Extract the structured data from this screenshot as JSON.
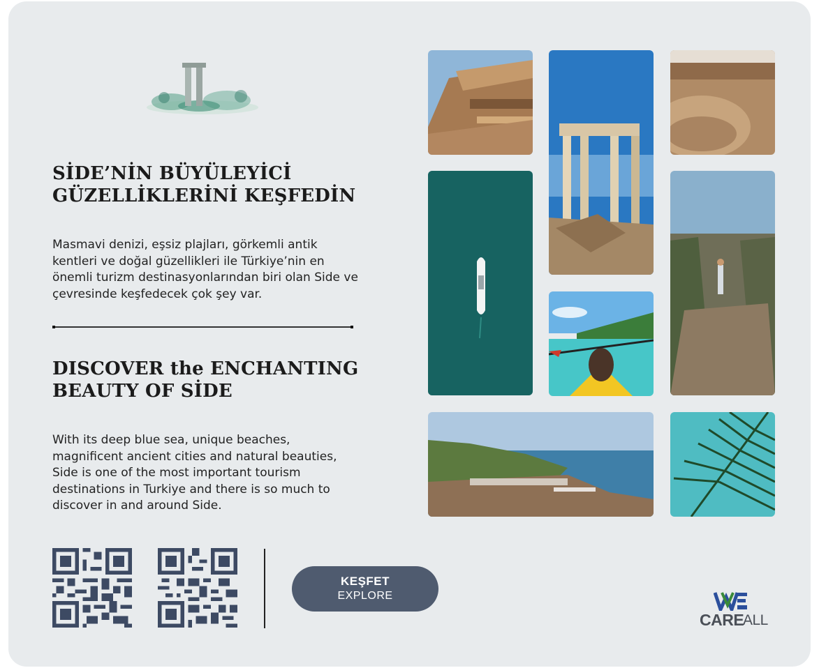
{
  "heading_tr": "SİDE’NİN BÜYÜLEYİCİ\nGÜZELLİKLERİNİ KEŞFEDİN",
  "paragraph_tr": "Masmavi denizi, eşsiz plajları, görkemli antik kentleri ve doğal güzellikleri ile Türkiye’nin en önemli turizm destinasyonlarından biri olan Side ve çevresinde keşfedecek çok şey var.",
  "heading_en": "DISCOVER the ENCHANTING\nBEAUTY OF SİDE",
  "paragraph_en": "With its deep blue sea, unique beaches, magnificent ancient cities and natural beauties, Side is one of the most important tourism destinations in Turkiye and there is so much to discover in and around Side.",
  "cta": {
    "label_tr": "KEŞFET",
    "label_en": "EXPLORE"
  },
  "brand": {
    "we": "WE",
    "care": "CARE",
    "all": "ALL"
  },
  "photos": [
    "temple-frieze",
    "temple-columns",
    "amphitheater",
    "yacht-sea",
    "hiker-canyon",
    "kayak",
    "harbor",
    "palm-leaves"
  ],
  "colors": {
    "background": "#e8ebed",
    "button": "#4f5b6f",
    "brand_green": "#3a8a3a",
    "brand_blue": "#2b4f9c"
  }
}
